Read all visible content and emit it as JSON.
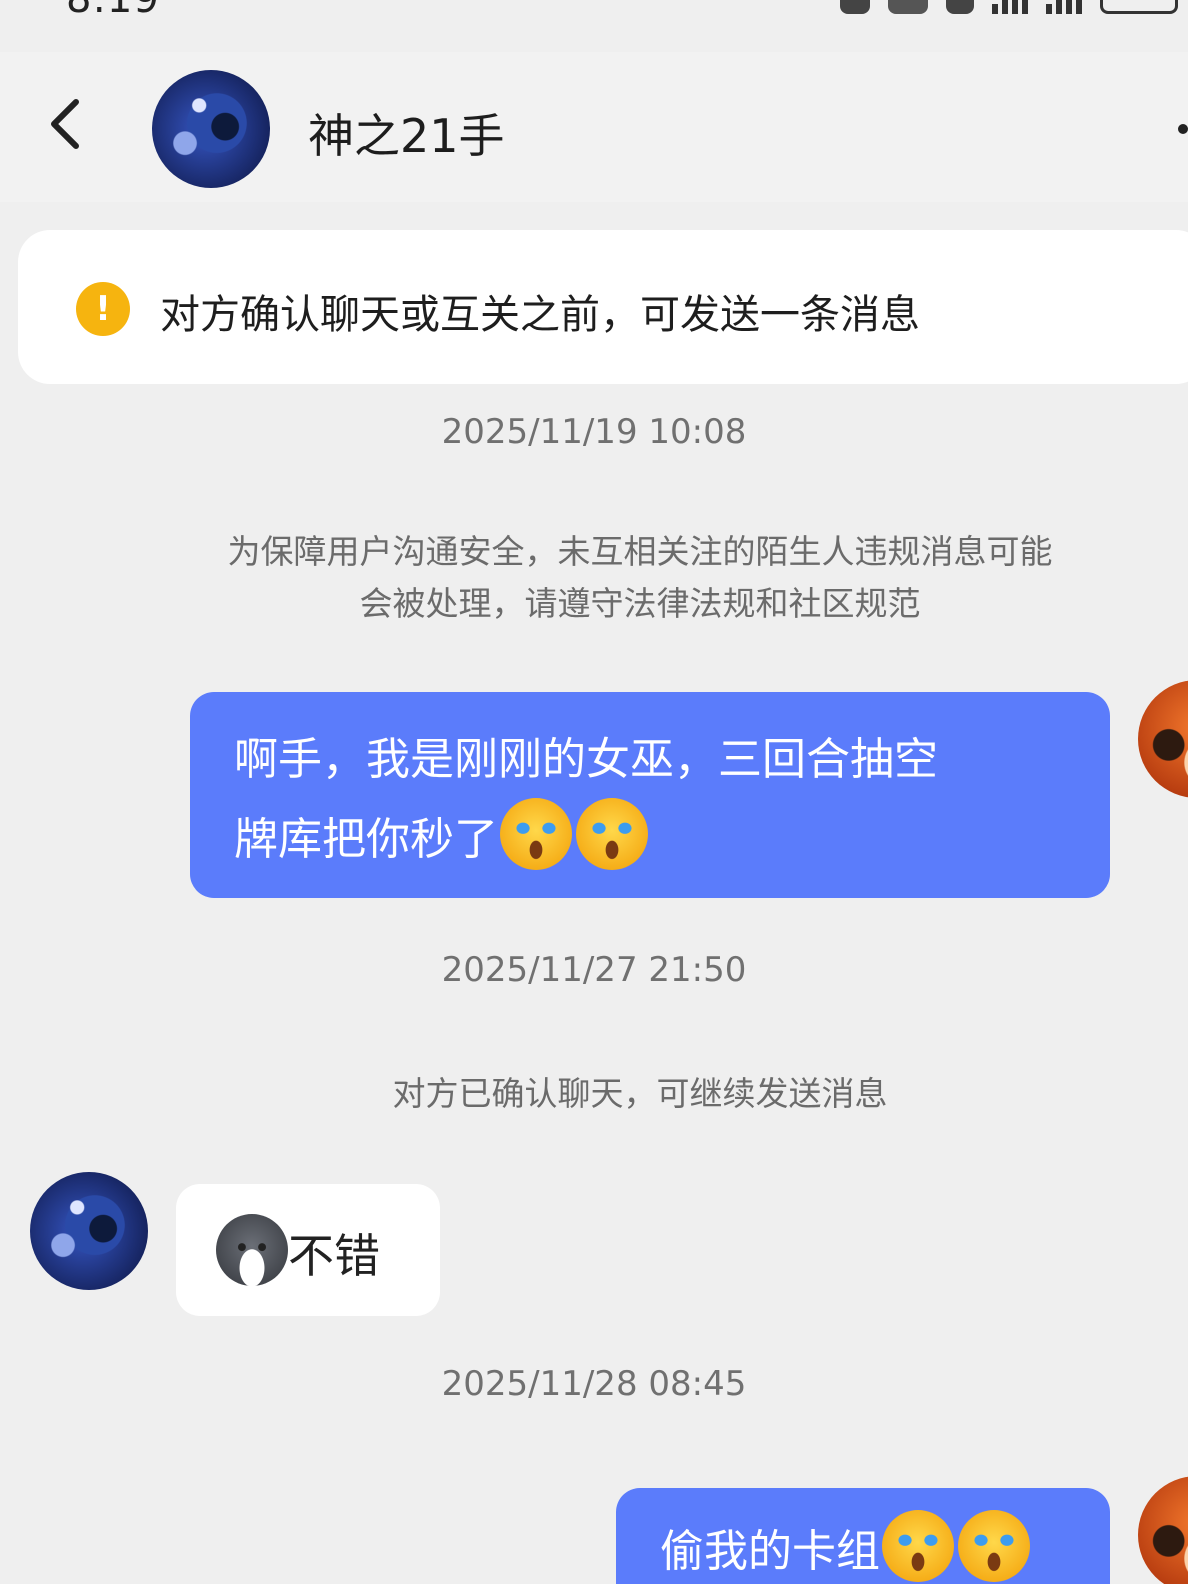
{
  "status_bar": {
    "time": "8:19"
  },
  "header": {
    "title": "神之21手",
    "back_icon": "chevron-left-icon",
    "more_icon": "more-dots-icon"
  },
  "notice": {
    "icon": "exclamation-circle-icon",
    "icon_glyph": "!",
    "text": "对方确认聊天或互关之前，可发送一条消息",
    "icon_color": "#f6b40f"
  },
  "messages": {
    "ts1": "2025/11/19 10:08",
    "sys1_line1": "为保障用户沟通安全，未互相关注的陌生人违规消息可能",
    "sys1_line2": "会被处理，请遵守法律法规和社区规范",
    "msg1_line1": "啊手，我是刚刚的女巫，三回合抽空",
    "msg1_line2": "牌库把你秒了",
    "ts2": "2025/11/27 21:50",
    "sys2": "对方已确认聊天，可继续发送消息",
    "reply1_text": "不错",
    "ts3": "2025/11/28 08:45",
    "msg2_text": "偷我的卡组"
  },
  "colors": {
    "outgoing_bubble": "#5b7cfb",
    "incoming_bubble": "#ffffff",
    "background": "#efefef"
  }
}
